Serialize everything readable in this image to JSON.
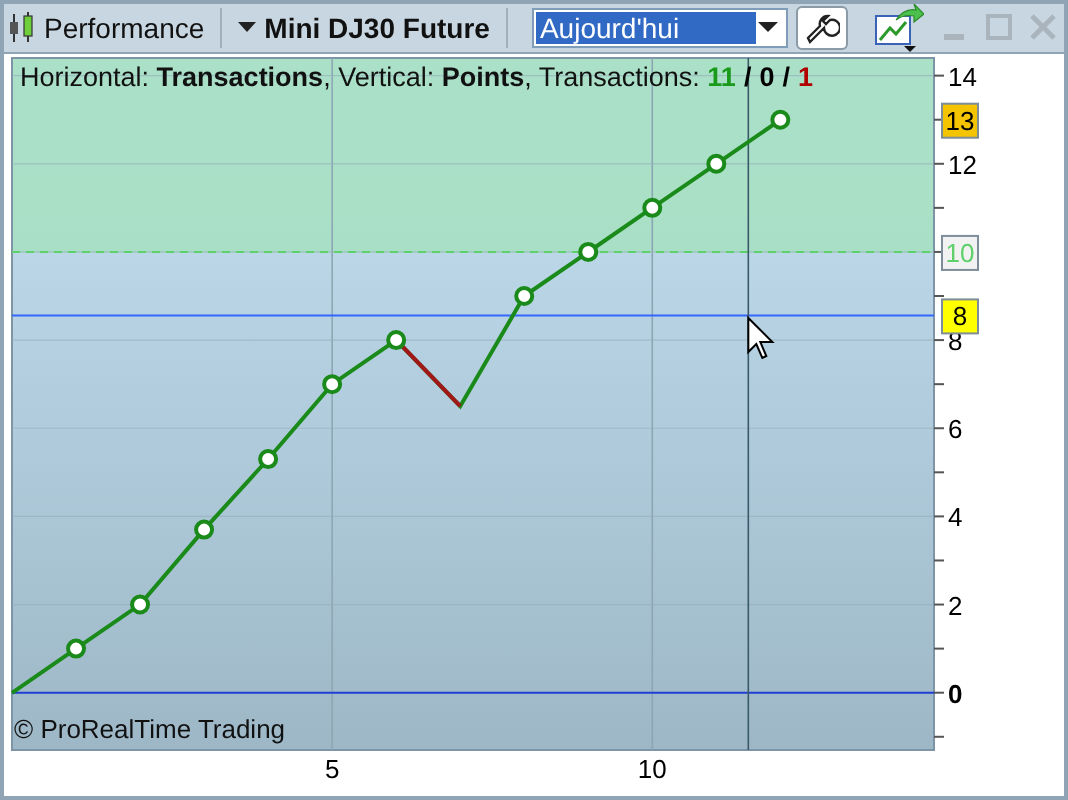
{
  "toolbar": {
    "title": "Performance",
    "instrument": "Mini DJ30 Future",
    "period": {
      "value": "Aujourd'hui"
    }
  },
  "chart": {
    "info": {
      "text": "Horizontal: **Transactions**, Vertical: **Points**, Transactions:",
      "counts": [
        {
          "text": "11",
          "kind": "win"
        },
        {
          "text": "/",
          "kind": "sep"
        },
        {
          "text": "0",
          "kind": "even"
        },
        {
          "text": "/",
          "kind": "sep"
        },
        {
          "text": "1",
          "kind": "loss"
        }
      ]
    },
    "copyright": "© ProRealTime Trading",
    "markers": [
      {
        "label": "13",
        "kind": "last"
      },
      {
        "label": "10",
        "kind": "zone"
      },
      {
        "label": "8",
        "kind": "cursor"
      }
    ],
    "chart_data": {
      "type": "line",
      "x": [
        0,
        1,
        2,
        3,
        4,
        5,
        6,
        7,
        8,
        9,
        10,
        11,
        12
      ],
      "series": [
        {
          "color": "#1a8a1a",
          "marker": "circle",
          "values": [
            0,
            1,
            2,
            3.7,
            5.3,
            7,
            8,
            6.5,
            9,
            10,
            11,
            12,
            13
          ]
        },
        {
          "color": "#a01818",
          "values": [
            null,
            null,
            null,
            null,
            null,
            null,
            8,
            6.5,
            null,
            null,
            null,
            null,
            null
          ]
        }
      ],
      "grid": true,
      "ref_lines": [
        {
          "axis": "y",
          "value": 10,
          "color": "#5fd06a"
        },
        {
          "axis": "y",
          "value": 0,
          "color": "#1f3fd0"
        },
        {
          "axis": "y",
          "value": 8.56,
          "color": "#3366ff"
        },
        {
          "axis": "x",
          "value": 11.5,
          "color": "#3a5a6a"
        }
      ],
      "xlim": [
        0,
        14.4
      ],
      "ylim": [
        -1.3,
        14.4
      ],
      "xticks": [
        5,
        10
      ],
      "yticks": [
        0,
        2,
        4,
        6,
        8,
        10,
        12,
        14
      ]
    }
  }
}
